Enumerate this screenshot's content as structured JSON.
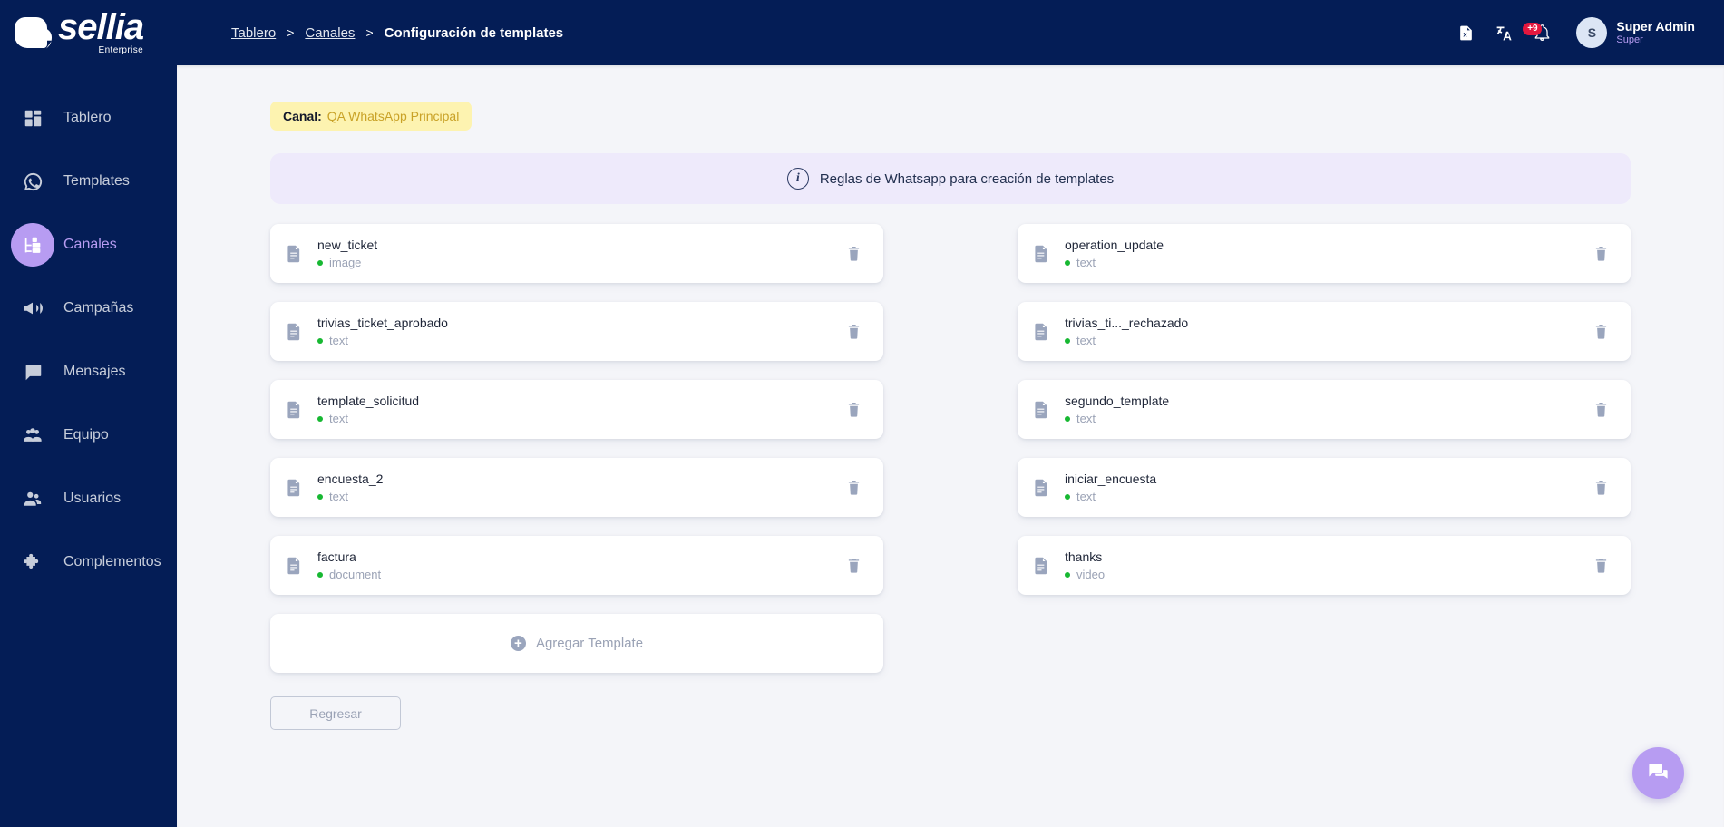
{
  "brand": {
    "name": "sellia",
    "tagline": "Enterprise"
  },
  "sidebar": {
    "items": [
      {
        "label": "Tablero",
        "icon": "dashboard-icon",
        "active": false
      },
      {
        "label": "Templates",
        "icon": "whatsapp-icon",
        "active": false
      },
      {
        "label": "Canales",
        "icon": "channels-icon",
        "active": true
      },
      {
        "label": "Campañas",
        "icon": "megaphone-icon",
        "active": false
      },
      {
        "label": "Mensajes",
        "icon": "chat-icon",
        "active": false
      },
      {
        "label": "Equipo",
        "icon": "group-icon",
        "active": false
      },
      {
        "label": "Usuarios",
        "icon": "users-icon",
        "active": false
      },
      {
        "label": "Complementos",
        "icon": "puzzle-icon",
        "active": false
      }
    ]
  },
  "topbar": {
    "breadcrumb": [
      {
        "label": "Tablero",
        "link": true
      },
      {
        "label": "Canales",
        "link": true
      },
      {
        "label": "Configuración de templates",
        "link": false
      }
    ],
    "separator": ">",
    "icons": [
      {
        "name": "export-excel-icon"
      },
      {
        "name": "translate-icon"
      },
      {
        "name": "notifications-bell-icon",
        "badge": "+9"
      }
    ],
    "notification_badge": "+9",
    "user": {
      "initial": "S",
      "name": "Super Admin",
      "role": "Super"
    }
  },
  "content": {
    "channel": {
      "label": "Canal:",
      "value": "QA WhatsApp Principal"
    },
    "rules_banner": {
      "icon": "info-icon",
      "text": "Reglas de Whatsapp para creación de templates"
    },
    "templates": [
      {
        "name": "new_ticket",
        "type": "image",
        "status_color": "#17b832"
      },
      {
        "name": "operation_update",
        "type": "text",
        "status_color": "#17b832"
      },
      {
        "name": "trivias_ticket_aprobado",
        "type": "text",
        "status_color": "#17b832"
      },
      {
        "name": "trivias_ti..._rechazado",
        "type": "text",
        "status_color": "#17b832"
      },
      {
        "name": "template_solicitud",
        "type": "text",
        "status_color": "#17b832"
      },
      {
        "name": "segundo_template",
        "type": "text",
        "status_color": "#17b832"
      },
      {
        "name": "encuesta_2",
        "type": "text",
        "status_color": "#17b832"
      },
      {
        "name": "iniciar_encuesta",
        "type": "text",
        "status_color": "#17b832"
      },
      {
        "name": "factura",
        "type": "document",
        "status_color": "#17b832"
      },
      {
        "name": "thanks",
        "type": "video",
        "status_color": "#17b832"
      }
    ],
    "add_template_label": "Agregar Template",
    "back_button_label": "Regresar"
  },
  "fab": {
    "icon": "chat-bubbles-icon"
  },
  "colors": {
    "sidebar_bg": "#041d56",
    "accent_purple": "#b79cf2",
    "channel_pill_bg": "#fdf3b0",
    "channel_pill_text": "#c9a227",
    "banner_bg": "#eeeafb",
    "badge_red": "#e3173e",
    "status_green": "#17b832",
    "page_bg": "#f4f5f9"
  }
}
